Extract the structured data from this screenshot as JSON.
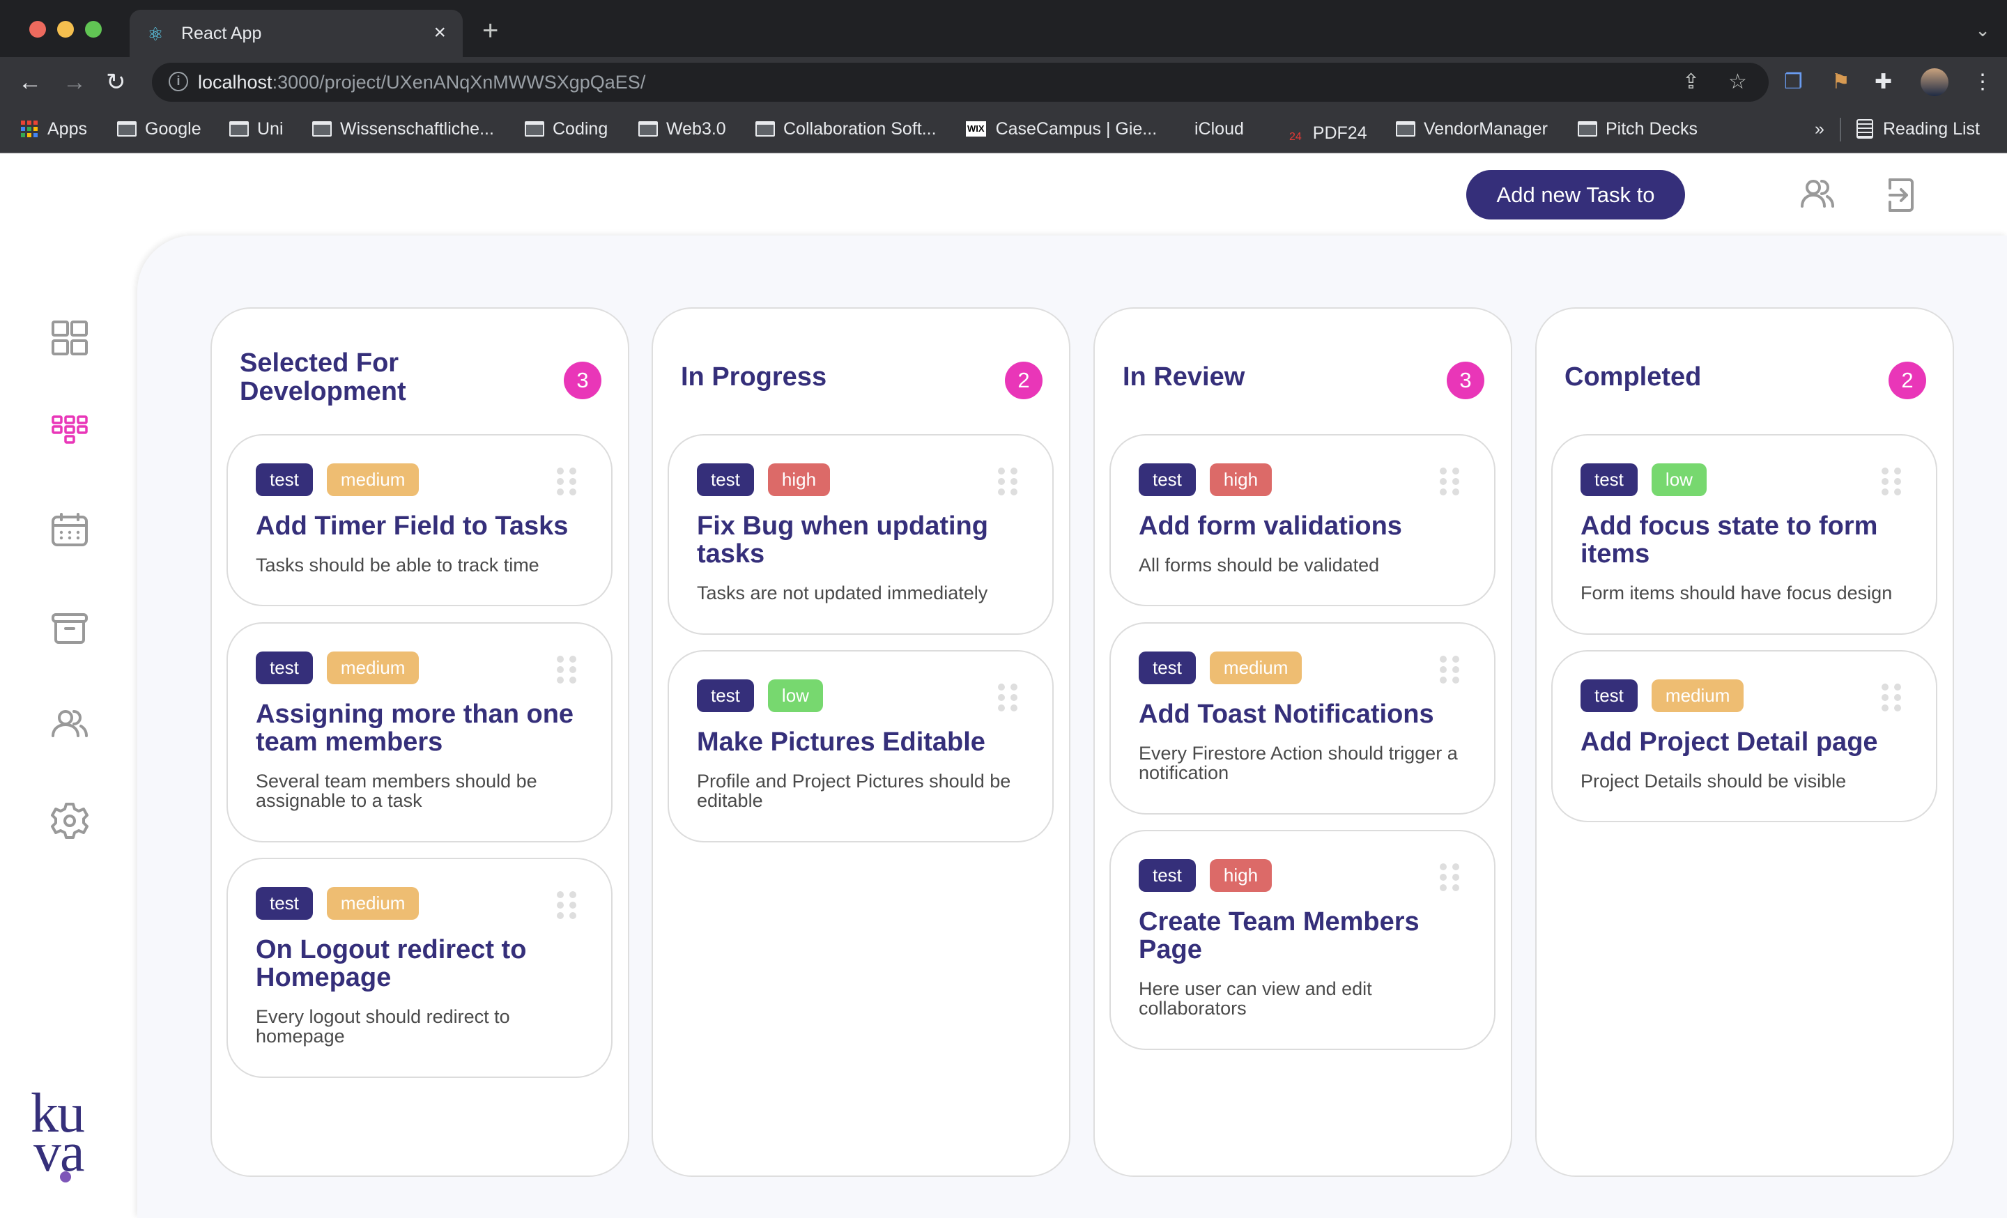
{
  "browser": {
    "tab_title": "React App",
    "tab_icon": "react-icon",
    "url_host": "localhost",
    "url_path": ":3000/project/UXenANqXnMWWSXgpQaES/",
    "bookmarks": [
      {
        "label": "Apps",
        "icon": "apps-grid-icon"
      },
      {
        "label": "Google",
        "icon": "folder-icon"
      },
      {
        "label": "Uni",
        "icon": "folder-icon"
      },
      {
        "label": "Wissenschaftliche...",
        "icon": "folder-icon"
      },
      {
        "label": "Coding",
        "icon": "folder-icon"
      },
      {
        "label": "Web3.0",
        "icon": "folder-icon"
      },
      {
        "label": "Collaboration Soft...",
        "icon": "folder-icon"
      },
      {
        "label": "CaseCampus | Gie...",
        "icon": "wix-icon"
      },
      {
        "label": "iCloud",
        "icon": "apple-icon"
      },
      {
        "label": "PDF24",
        "icon": "pdf24-icon"
      },
      {
        "label": "VendorManager",
        "icon": "folder-icon"
      },
      {
        "label": "Pitch Decks",
        "icon": "folder-icon"
      }
    ],
    "bookmarks_overflow": "»",
    "reading_list": "Reading List"
  },
  "header": {
    "add_task_label": "Add new Task to Backlog"
  },
  "sidebar": {
    "items": [
      {
        "name": "dashboard",
        "icon": "grid-icon",
        "active": false
      },
      {
        "name": "board",
        "icon": "kanban-icon",
        "active": true
      },
      {
        "name": "calendar",
        "icon": "calendar-icon",
        "active": false
      },
      {
        "name": "archive",
        "icon": "archive-icon",
        "active": false
      },
      {
        "name": "team",
        "icon": "users-icon",
        "active": false
      },
      {
        "name": "settings",
        "icon": "gear-icon",
        "active": false
      }
    ],
    "logo_line1": "ku",
    "logo_line2": "va"
  },
  "colors": {
    "primary": "#352f7a",
    "accent": "#e936b8",
    "tag_test": "#352f7a",
    "priority_high": "#dc6a68",
    "priority_medium": "#eebd72",
    "priority_low": "#77d86f"
  },
  "board": {
    "columns": [
      {
        "title": "Selected For Development",
        "count": "3",
        "cards": [
          {
            "tag": "test",
            "priority": "medium",
            "title": "Add Timer Field to Tasks",
            "description": "Tasks should be able to track time"
          },
          {
            "tag": "test",
            "priority": "medium",
            "title": "Assigning more than one team members",
            "description": "Several team members should be assignable to a task"
          },
          {
            "tag": "test",
            "priority": "medium",
            "title": "On Logout redirect to Homepage",
            "description": "Every logout should redirect to homepage"
          }
        ]
      },
      {
        "title": "In Progress",
        "count": "2",
        "cards": [
          {
            "tag": "test",
            "priority": "high",
            "title": "Fix Bug when updating tasks",
            "description": "Tasks are not updated immediately"
          },
          {
            "tag": "test",
            "priority": "low",
            "title": "Make Pictures Editable",
            "description": "Profile and Project Pictures should be editable"
          }
        ]
      },
      {
        "title": "In Review",
        "count": "3",
        "cards": [
          {
            "tag": "test",
            "priority": "high",
            "title": "Add form validations",
            "description": "All forms should be validated"
          },
          {
            "tag": "test",
            "priority": "medium",
            "title": "Add Toast Notifications",
            "description": "Every Firestore Action should trigger a notification"
          },
          {
            "tag": "test",
            "priority": "high",
            "title": "Create Team Members Page",
            "description": "Here user can view and edit collaborators"
          }
        ]
      },
      {
        "title": "Completed",
        "count": "2",
        "cards": [
          {
            "tag": "test",
            "priority": "low",
            "title": "Add focus state to form items",
            "description": "Form items should have focus design"
          },
          {
            "tag": "test",
            "priority": "medium",
            "title": "Add Project Detail page",
            "description": "Project Details should be visible"
          }
        ]
      }
    ]
  }
}
